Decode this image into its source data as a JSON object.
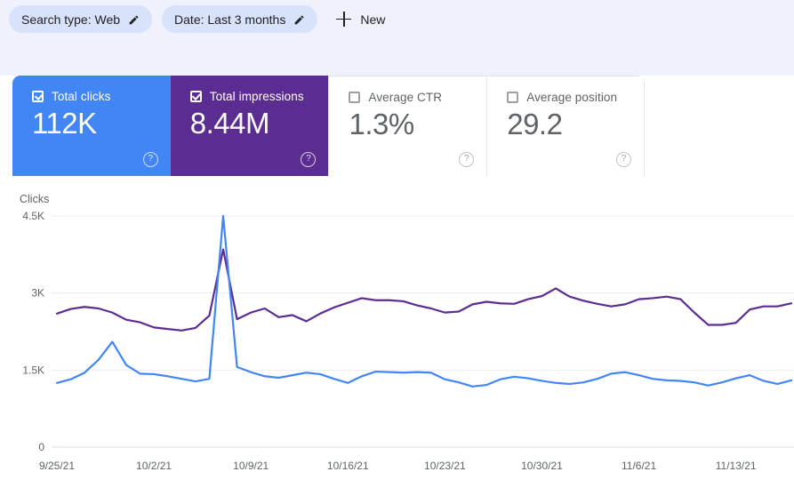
{
  "filters": {
    "chips": [
      {
        "label": "Search type: Web",
        "icon": "pencil-icon"
      },
      {
        "label": "Date: Last 3 months",
        "icon": "pencil-icon"
      }
    ],
    "new_button": {
      "label": "New",
      "icon": "plus-icon"
    }
  },
  "metrics": [
    {
      "key": "total-clicks",
      "label": "Total clicks",
      "value": "112K",
      "selected": true,
      "color": "#4285f4",
      "help": "?"
    },
    {
      "key": "total-impressions",
      "label": "Total impressions",
      "value": "8.44M",
      "selected": true,
      "color": "#5c2d91",
      "help": "?"
    },
    {
      "key": "average-ctr",
      "label": "Average CTR",
      "value": "1.3%",
      "selected": false,
      "color": "#ffffff",
      "help": "?"
    },
    {
      "key": "average-position",
      "label": "Average position",
      "value": "29.2",
      "selected": false,
      "color": "#ffffff",
      "help": "?"
    }
  ],
  "chart_data": {
    "type": "line",
    "title": "",
    "ylabel": "Clicks",
    "xlabel": "",
    "grid": true,
    "legend_position": "none",
    "ylim": [
      0,
      4500
    ],
    "yticks": [
      0,
      1500,
      3000,
      4500
    ],
    "ytick_labels": [
      "0",
      "1.5K",
      "3K",
      "4.5K"
    ],
    "xticks": [
      "9/25/21",
      "10/2/21",
      "10/9/21",
      "10/16/21",
      "10/23/21",
      "10/30/21",
      "11/6/21",
      "11/13/21"
    ],
    "x": [
      "9/25/21",
      "9/26/21",
      "9/27/21",
      "9/28/21",
      "9/29/21",
      "9/30/21",
      "10/1/21",
      "10/2/21",
      "10/3/21",
      "10/4/21",
      "10/5/21",
      "10/6/21",
      "10/7/21",
      "10/8/21",
      "10/9/21",
      "10/10/21",
      "10/11/21",
      "10/12/21",
      "10/13/21",
      "10/14/21",
      "10/15/21",
      "10/16/21",
      "10/17/21",
      "10/18/21",
      "10/19/21",
      "10/20/21",
      "10/21/21",
      "10/22/21",
      "10/23/21",
      "10/24/21",
      "10/25/21",
      "10/26/21",
      "10/27/21",
      "10/28/21",
      "10/29/21",
      "10/30/21",
      "10/31/21",
      "11/1/21",
      "11/2/21",
      "11/3/21",
      "11/4/21",
      "11/5/21",
      "11/6/21",
      "11/7/21",
      "11/8/21",
      "11/9/21",
      "11/10/21",
      "11/11/21",
      "11/12/21",
      "11/13/21",
      "11/14/21",
      "11/15/21",
      "11/16/21",
      "11/17/21"
    ],
    "series": [
      {
        "name": "Total impressions",
        "color": "#5c2d91",
        "values": [
          2600,
          2690,
          2730,
          2700,
          2620,
          2480,
          2430,
          2330,
          2300,
          2270,
          2320,
          2560,
          3850,
          2490,
          2620,
          2700,
          2530,
          2570,
          2450,
          2600,
          2720,
          2810,
          2900,
          2860,
          2860,
          2840,
          2760,
          2700,
          2620,
          2640,
          2780,
          2830,
          2800,
          2790,
          2880,
          2940,
          3090,
          2930,
          2850,
          2790,
          2740,
          2780,
          2880,
          2900,
          2930,
          2880,
          2620,
          2380,
          2380,
          2420,
          2680,
          2740,
          2740,
          2800
        ]
      },
      {
        "name": "Total clicks",
        "color": "#4285f4",
        "values": [
          1250,
          1320,
          1450,
          1700,
          2050,
          1600,
          1430,
          1420,
          1380,
          1330,
          1280,
          1330,
          4500,
          1560,
          1460,
          1380,
          1350,
          1400,
          1450,
          1420,
          1330,
          1250,
          1380,
          1470,
          1460,
          1450,
          1460,
          1450,
          1320,
          1260,
          1180,
          1210,
          1320,
          1370,
          1340,
          1290,
          1250,
          1230,
          1260,
          1330,
          1430,
          1460,
          1400,
          1330,
          1300,
          1290,
          1260,
          1200,
          1260,
          1340,
          1400,
          1290,
          1230,
          1300
        ]
      }
    ]
  }
}
